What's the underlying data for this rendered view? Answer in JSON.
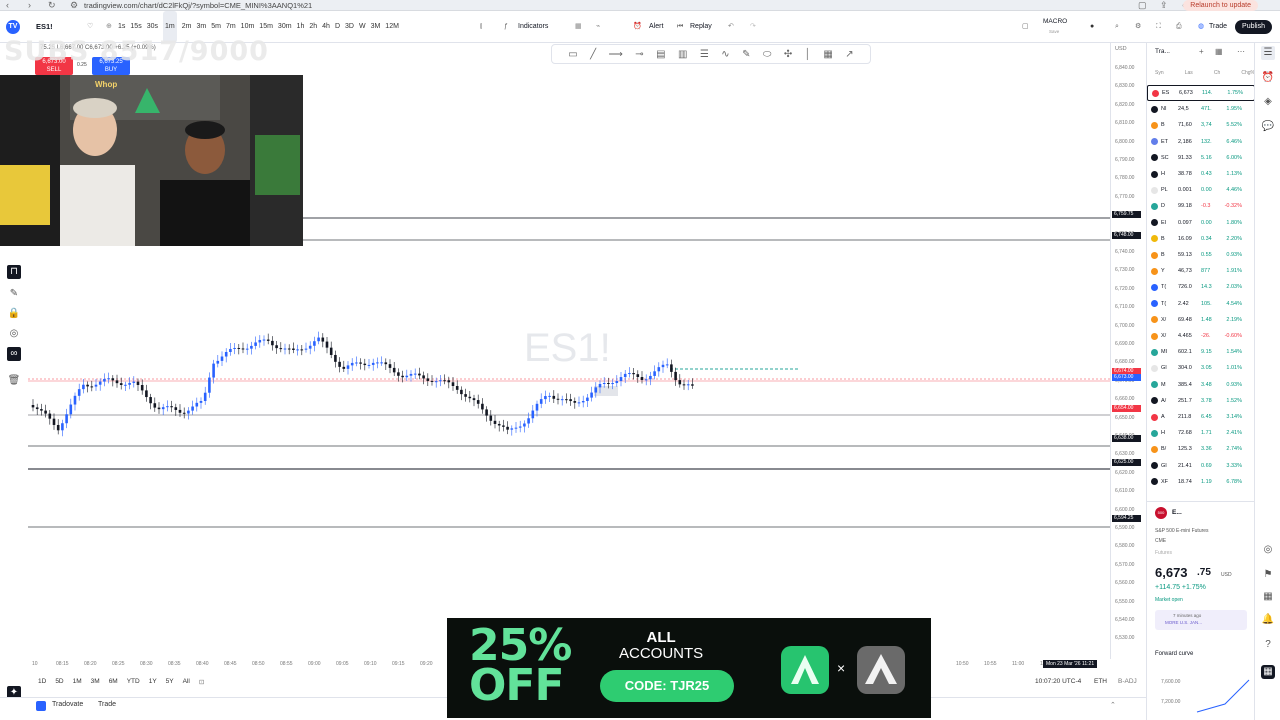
{
  "browser": {
    "url": "tradingview.com/chart/dC2lFkQj/?symbol=CME_MINI%3AANQ1%21",
    "relaunch_label": "Relaunch to update"
  },
  "topbar": {
    "symbol": "ES1!",
    "timeframes": [
      "1s",
      "15s",
      "30s",
      "1m",
      "2m",
      "3m",
      "5m",
      "7m",
      "10m",
      "15m",
      "30m",
      "1h",
      "2h",
      "4h",
      "D",
      "3D",
      "W",
      "3M",
      "12M"
    ],
    "active_timeframe": "1m",
    "indicators_label": "Indicators",
    "alert_label": "Alert",
    "replay_label": "Replay",
    "macro_label": "MACRO",
    "macro_sub": "Save",
    "trade_label": "Trade",
    "publish_label": "Publish"
  },
  "legend": {
    "ohlc": "75.25 L6,667.00 C6,673.00 +6.25 (+0.09%)",
    "sell_price": "6,673.00",
    "sell_label": "SELL",
    "spread": "0.25",
    "buy_price": "6,673.25",
    "buy_label": "BUY"
  },
  "chart": {
    "watermark": "ES1!",
    "colors": {
      "up": "#2962ff",
      "down": "#131722",
      "long": "#26a69a"
    }
  },
  "price_axis": {
    "currency": "USD",
    "labels": [
      "6,840.00",
      "6,830.00",
      "6,820.00",
      "6,810.00",
      "6,800.00",
      "6,790.00",
      "6,780.00",
      "6,770.00",
      "6,760.00",
      "6,750.00",
      "6,740.00",
      "6,730.00",
      "6,720.00",
      "6,710.00",
      "6,700.00",
      "6,690.00",
      "6,680.00",
      "6,670.00",
      "6,660.00",
      "6,650.00",
      "6,640.00",
      "6,630.00",
      "6,620.00",
      "6,610.00",
      "6,600.00",
      "6,590.00",
      "6,580.00",
      "6,570.00",
      "6,560.00",
      "6,550.00",
      "6,540.00",
      "6,530.00"
    ],
    "tags": [
      {
        "text": "6,759.75",
        "color": "#131722"
      },
      {
        "text": "6,748.00",
        "color": "#131722"
      },
      {
        "text": "6,674.00",
        "color": "#f23645"
      },
      {
        "text": "6,673.00",
        "color": "#2962ff"
      },
      {
        "text": "6,654.00",
        "color": "#f23645"
      },
      {
        "text": "6,638.00",
        "color": "#131722"
      },
      {
        "text": "6,625.00",
        "color": "#131722"
      },
      {
        "text": "6,594.25",
        "color": "#131722"
      }
    ]
  },
  "time_axis": {
    "labels": [
      "10",
      "08:15",
      "08:20",
      "08:25",
      "08:30",
      "08:35",
      "08:40",
      "08:45",
      "08:50",
      "08:55",
      "09:00",
      "09:05",
      "09:10",
      "09:15",
      "09:20",
      "10:50",
      "10:55",
      "11:00",
      "11:05"
    ],
    "cursor_time": "Mon 23 Mar '26  11:21"
  },
  "bottombar": {
    "ranges": [
      "1D",
      "5D",
      "1M",
      "3M",
      "6M",
      "YTD",
      "1Y",
      "5Y",
      "All"
    ],
    "clock": "10:07:20 UTC-4",
    "session": "ETH",
    "adj": "B-ADJ"
  },
  "statusbar": {
    "broker": "Tradovate",
    "trade": "Trade"
  },
  "watchlist": {
    "title": "Tra...",
    "headers": [
      "Syn",
      "Las",
      "Ch",
      "Chg%"
    ],
    "rows": [
      {
        "sym": "ES",
        "last": "6,673",
        "chg": "114.",
        "pct": "1.75%",
        "color": "#f23645",
        "neg": false
      },
      {
        "sym": "NI",
        "last": "24,5",
        "chg": "471.",
        "pct": "1.95%",
        "color": "#131722",
        "neg": false
      },
      {
        "sym": "B",
        "last": "71,60",
        "chg": "3,74",
        "pct": "5.52%",
        "color": "#f7931a",
        "neg": false
      },
      {
        "sym": "ET",
        "last": "2,186",
        "chg": "132.",
        "pct": "6.46%",
        "color": "#627eea",
        "neg": false
      },
      {
        "sym": "SC",
        "last": "91.33",
        "chg": "5.16",
        "pct": "6.00%",
        "color": "#131722",
        "neg": false
      },
      {
        "sym": "H",
        "last": "38.78",
        "chg": "0.43",
        "pct": "1.13%",
        "color": "#131722",
        "neg": false
      },
      {
        "sym": "PL",
        "last": "0.001",
        "chg": "0.00",
        "pct": "4.46%",
        "color": "#e6e6e6",
        "neg": false
      },
      {
        "sym": "D",
        "last": "99.18",
        "chg": "-0.3",
        "pct": "-0.32%",
        "color": "#26a69a",
        "neg": true
      },
      {
        "sym": "EI",
        "last": "0.097",
        "chg": "0.00",
        "pct": "1.80%",
        "color": "#131722",
        "neg": false
      },
      {
        "sym": "B",
        "last": "16.09",
        "chg": "0.34",
        "pct": "2.20%",
        "color": "#f0b90b",
        "neg": false
      },
      {
        "sym": "B",
        "last": "59.13",
        "chg": "0.55",
        "pct": "0.93%",
        "color": "#f7931a",
        "neg": false
      },
      {
        "sym": "Y",
        "last": "46,73",
        "chg": "877",
        "pct": "1.91%",
        "color": "#f7931a",
        "neg": false
      },
      {
        "sym": "T(",
        "last": "726.0",
        "chg": "14.3",
        "pct": "2.03%",
        "color": "#2962ff",
        "neg": false
      },
      {
        "sym": "T(",
        "last": "2.42",
        "chg": "105.",
        "pct": "4.54%",
        "color": "#2962ff",
        "neg": false
      },
      {
        "sym": "X/",
        "last": "69.48",
        "chg": "1.48",
        "pct": "2.19%",
        "color": "#f7931a",
        "neg": false
      },
      {
        "sym": "X/",
        "last": "4.465",
        "chg": "-26.",
        "pct": "-0.60%",
        "color": "#f7931a",
        "neg": true
      },
      {
        "sym": "MI",
        "last": "602.1",
        "chg": "9.15",
        "pct": "1.54%",
        "color": "#26a69a",
        "neg": false
      },
      {
        "sym": "GI",
        "last": "304.0",
        "chg": "3.05",
        "pct": "1.01%",
        "color": "#e6e6e6",
        "neg": false
      },
      {
        "sym": "M",
        "last": "385.4",
        "chg": "3.48",
        "pct": "0.93%",
        "color": "#26a69a",
        "neg": false
      },
      {
        "sym": "A/",
        "last": "251.7",
        "chg": "3.78",
        "pct": "1.52%",
        "color": "#131722",
        "neg": false
      },
      {
        "sym": "A",
        "last": "211.8",
        "chg": "6.45",
        "pct": "3.14%",
        "color": "#f23645",
        "neg": false
      },
      {
        "sym": "H",
        "last": "72.68",
        "chg": "1.71",
        "pct": "2.41%",
        "color": "#26a69a",
        "neg": false
      },
      {
        "sym": "B/",
        "last": "125.3",
        "chg": "3.36",
        "pct": "2.74%",
        "color": "#f7931a",
        "neg": false
      },
      {
        "sym": "GI",
        "last": "21.41",
        "chg": "0.69",
        "pct": "3.33%",
        "color": "#131722",
        "neg": false
      },
      {
        "sym": "XF",
        "last": "18.74",
        "chg": "1.19",
        "pct": "6.78%",
        "color": "#131722",
        "neg": false
      }
    ],
    "details": {
      "symbol": "E...",
      "name": "S&P 500 E-mini Futures",
      "exchange": "CME",
      "type": "Futures",
      "price_main": "6,673",
      "price_small": ".75",
      "currency": "USD",
      "change": "+114.75  +1.75%",
      "market": "Market open",
      "news_time": "7 minutes ago",
      "news_text": "MORE U.S. JAN...",
      "forward_curve": "Forward curve",
      "fc_levels": [
        "7,600.00",
        "7,200.00"
      ]
    }
  },
  "stream": {
    "subs_text": "SUBS 8517/9000",
    "logo": "Whop"
  },
  "ad": {
    "discount_line1": "25%",
    "discount_line2": "OFF",
    "all": "ALL",
    "accounts": "ACCOUNTS",
    "code": "CODE: TJR25",
    "x": "×"
  }
}
